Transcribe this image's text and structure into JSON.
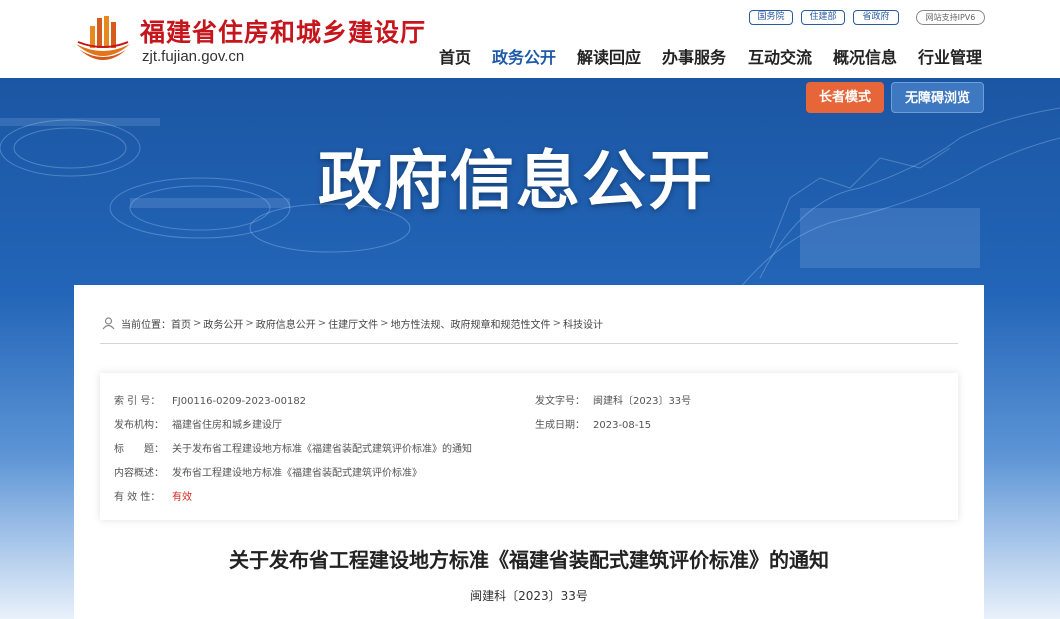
{
  "header": {
    "site_name": "福建省住房和城乡建设厅",
    "domain": "zjt.fujian.gov.cn",
    "top_links": [
      "国务院",
      "住建部",
      "省政府"
    ],
    "ipv6_badge": "网站支持IPV6",
    "nav": [
      "首页",
      "政务公开",
      "解读回应",
      "办事服务",
      "互动交流",
      "概况信息",
      "行业管理"
    ],
    "active_nav": "政务公开",
    "brand_color": "#c4161c",
    "accent_color": "#1f5aa8"
  },
  "banner": {
    "title": "政府信息公开",
    "elder_mode": "长者模式",
    "accessible": "无障碍浏览"
  },
  "breadcrumb": {
    "prefix": "当前位置：",
    "items": [
      "首页",
      "政务公开",
      "政府信息公开",
      "住建厅文件",
      "地方性法规、政府规章和规范性文件",
      "科技设计"
    ],
    "separator": ">"
  },
  "info": {
    "index_label": "索 引 号：",
    "index_value": "FJ00116-0209-2023-00182",
    "doc_no_label": "发文字号：",
    "doc_no_value": "闽建科〔2023〕33号",
    "org_label": "发布机构：",
    "org_value": "福建省住房和城乡建设厅",
    "date_label": "生成日期：",
    "date_value": "2023-08-15",
    "title_label": "标　　题：",
    "title_value": "关于发布省工程建设地方标准《福建省装配式建筑评价标准》的通知",
    "summary_label": "内容概述：",
    "summary_value": "发布省工程建设地方标准《福建省装配式建筑评价标准》",
    "validity_label": "有 效 性：",
    "validity_value": "有效"
  },
  "document": {
    "title": "关于发布省工程建设地方标准《福建省装配式建筑评价标准》的通知",
    "number": "闽建科〔2023〕33号"
  }
}
